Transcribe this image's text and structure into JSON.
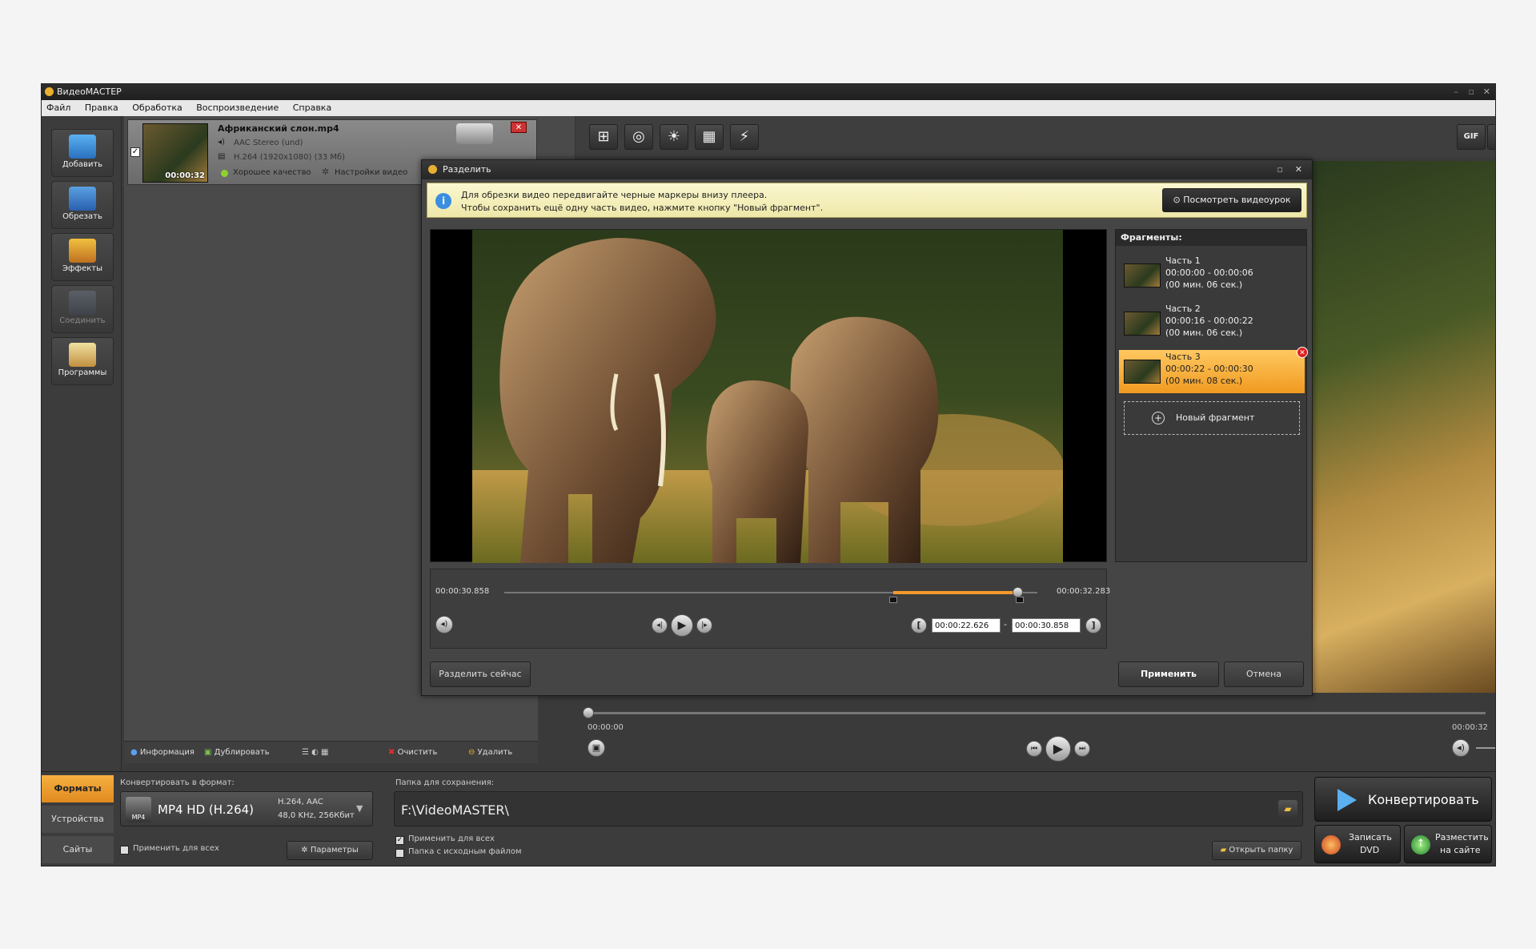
{
  "app": {
    "title": "ВидеоМАСТЕР"
  },
  "menu": [
    "Файл",
    "Правка",
    "Обработка",
    "Воспроизведение",
    "Справка"
  ],
  "sidebar_tools": [
    {
      "label": "Добавить",
      "icon": "add-icon",
      "color": "#4aa0e0"
    },
    {
      "label": "Обрезать",
      "icon": "cut-icon",
      "color": "#4a8ed6"
    },
    {
      "label": "Эффекты",
      "icon": "effects-icon",
      "color": "#e0a030"
    },
    {
      "label": "Соединить",
      "icon": "join-icon",
      "color": "#555a60"
    },
    {
      "label": "Программы",
      "icon": "programs-icon",
      "color": "#d8c070"
    }
  ],
  "file_item": {
    "name": "Африканский слон.mp4",
    "audio": "AAC Stereo (und)",
    "video": "H.264 (1920x1080) (33 Мб)",
    "duration": "00:00:32",
    "quality": "Хорошее качество",
    "settings": "Настройки видео"
  },
  "list_toolbar": {
    "info": "Информация",
    "duplicate": "Дублировать",
    "clear": "Очистить",
    "delete": "Удалить"
  },
  "top_tools": [
    "crop-icon",
    "snapshot-icon",
    "brightness-icon",
    "filmstrip-icon",
    "speed-icon"
  ],
  "right_tools": {
    "gif": "GIF",
    "fullscreen": "fullscreen-icon"
  },
  "dialog": {
    "title": "Разделить",
    "info_line1": "Для обрезки видео передвигайте черные маркеры внизу плеера.",
    "info_line2": "Чтобы сохранить ещё одну часть видео, нажмите кнопку \"Новый фрагмент\".",
    "tutorial_btn": "Посмотреть видеоурок",
    "fragments_title": "Фрагменты:",
    "fragments": [
      {
        "name": "Часть 1",
        "range": "00:00:00 - 00:00:06",
        "dur": "(00 мин. 06 сек.)"
      },
      {
        "name": "Часть 2",
        "range": "00:00:16 - 00:00:22",
        "dur": "(00 мин. 06 сек.)"
      },
      {
        "name": "Часть 3",
        "range": "00:00:22 - 00:00:30",
        "dur": "(00 мин. 08 сек.)"
      }
    ],
    "new_fragment": "Новый фрагмент",
    "time_left": "00:00:30.858",
    "time_right": "00:00:32.283",
    "selection": {
      "start_fraction": 0.73,
      "end_fraction": 0.967,
      "playhead_fraction": 0.962
    },
    "tc_start": "00:00:22.626",
    "tc_end": "00:00:30.858",
    "split_now": "Разделить сейчас",
    "apply": "Применить",
    "cancel": "Отмена",
    "accent": "#f39a2c"
  },
  "main_player": {
    "time_start": "00:00:00",
    "time_end": "00:00:32"
  },
  "bottom": {
    "tabs": [
      "Форматы",
      "Устройства",
      "Сайты"
    ],
    "format_label": "Конвертировать в формат:",
    "format_name": "MP4 HD (H.264)",
    "format_codec": "H.264, AAC",
    "format_audio": "48,0 KHz, 256Кбит",
    "apply_all": "Применить для всех",
    "params": "Параметры",
    "folder_label": "Папка для сохранения:",
    "folder_path": "F:\\VideoMASTER\\",
    "apply_all2": "Применить для всех",
    "source_folder": "Папка с исходным файлом",
    "open_folder": "Открыть папку",
    "convert": "Конвертировать",
    "burn_dvd_1": "Записать",
    "burn_dvd_2": "DVD",
    "publish_1": "Разместить",
    "publish_2": "на сайте",
    "tab_active_color": "#f0a030"
  }
}
